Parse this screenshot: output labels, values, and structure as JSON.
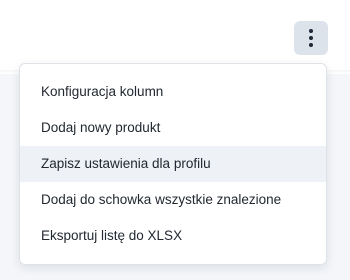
{
  "toolbar": {
    "more_button_icon": "kebab-vertical-icon"
  },
  "menu": {
    "items": [
      {
        "label": "Konfiguracja kolumn"
      },
      {
        "label": "Dodaj nowy produkt"
      },
      {
        "label": "Zapisz ustawienia dla profilu",
        "highlighted": true
      },
      {
        "label": "Dodaj do schowka wszystkie znalezione"
      },
      {
        "label": "Eksportuj listę do XLSX"
      }
    ]
  },
  "colors": {
    "button_bg": "#dde3eb",
    "highlight_bg": "#eef1f5",
    "page_bg_lower": "#f4f6f9",
    "text": "#222831"
  }
}
